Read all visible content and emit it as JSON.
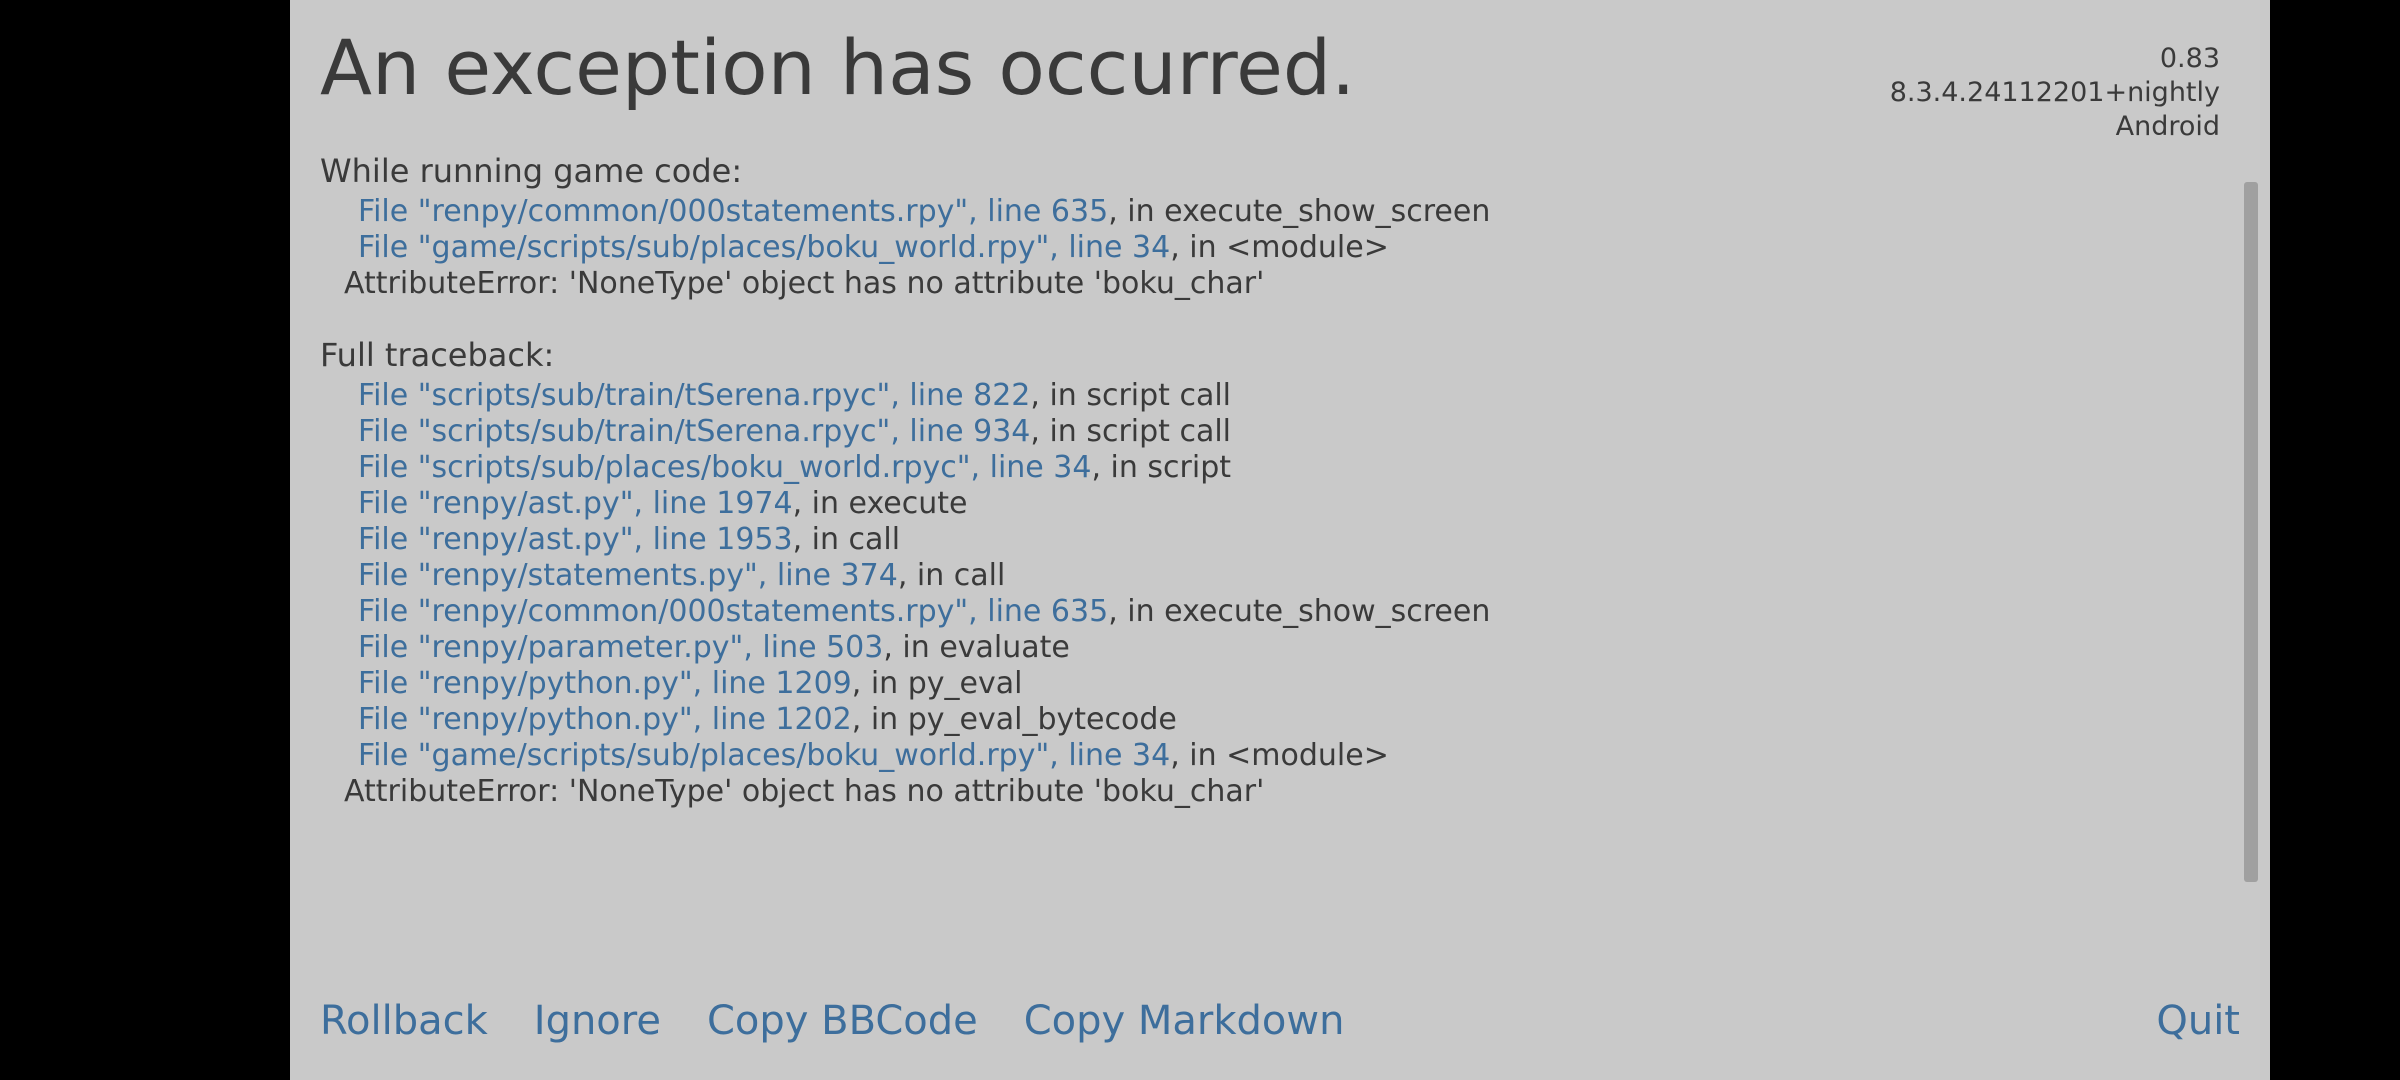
{
  "title": "An exception has occurred.",
  "version": {
    "game_version": "0.83",
    "engine_version": "8.3.4.24112201+nightly",
    "platform": "Android"
  },
  "sections": {
    "running": {
      "heading": "While running game code:",
      "lines": [
        {
          "file": "File \"renpy/common/000statements.rpy\", line 635",
          "suffix": ", in execute_show_screen"
        },
        {
          "file": "File \"game/scripts/sub/places/boku_world.rpy\", line 34",
          "suffix": ", in <module>"
        }
      ],
      "error": "AttributeError: 'NoneType' object has no attribute 'boku_char'"
    },
    "traceback": {
      "heading": "Full traceback:",
      "lines": [
        {
          "file": "File \"scripts/sub/train/tSerena.rpyc\", line 822",
          "suffix": ", in script call"
        },
        {
          "file": "File \"scripts/sub/train/tSerena.rpyc\", line 934",
          "suffix": ", in script call"
        },
        {
          "file": "File \"scripts/sub/places/boku_world.rpyc\", line 34",
          "suffix": ", in script"
        },
        {
          "file": "File \"renpy/ast.py\", line 1974",
          "suffix": ", in execute"
        },
        {
          "file": "File \"renpy/ast.py\", line 1953",
          "suffix": ", in call"
        },
        {
          "file": "File \"renpy/statements.py\", line 374",
          "suffix": ", in call"
        },
        {
          "file": "File \"renpy/common/000statements.rpy\", line 635",
          "suffix": ", in execute_show_screen"
        },
        {
          "file": "File \"renpy/parameter.py\", line 503",
          "suffix": ", in evaluate"
        },
        {
          "file": "File \"renpy/python.py\", line 1209",
          "suffix": ", in py_eval"
        },
        {
          "file": "File \"renpy/python.py\", line 1202",
          "suffix": ", in py_eval_bytecode"
        },
        {
          "file": "File \"game/scripts/sub/places/boku_world.rpy\", line 34",
          "suffix": ", in <module>"
        }
      ],
      "error": "AttributeError: 'NoneType' object has no attribute 'boku_char'"
    }
  },
  "buttons": {
    "rollback": "Rollback",
    "ignore": "Ignore",
    "copy_bbcode": "Copy BBCode",
    "copy_markdown": "Copy Markdown",
    "quit": "Quit"
  }
}
